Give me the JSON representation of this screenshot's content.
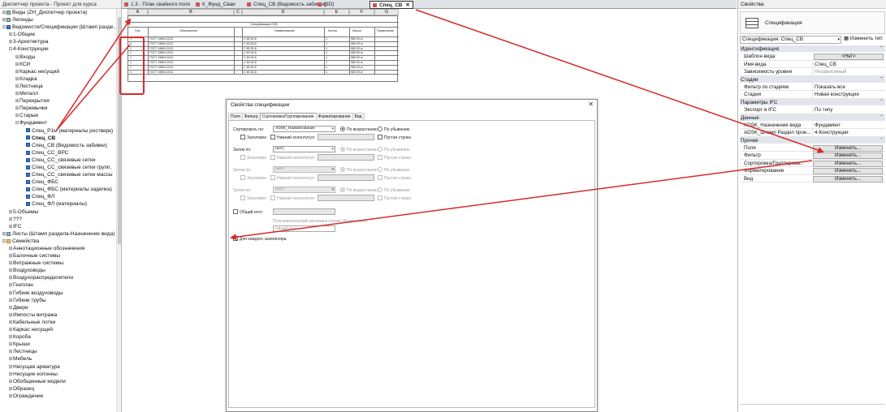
{
  "browser": {
    "title": "Диспетчер проекта - Проект для курса",
    "items": [
      {
        "label": "Виды (ZH_Диспетчер проекта)",
        "toggle": "⊞",
        "icon": "view",
        "indent": 0
      },
      {
        "label": "Легенды",
        "toggle": "⊞",
        "icon": "view",
        "indent": 0
      },
      {
        "label": "Ведомости/Спецификации (Штамп разде...",
        "toggle": "⊟",
        "icon": "sched",
        "indent": 0
      },
      {
        "label": "1-Общие",
        "toggle": "⊞",
        "icon": "",
        "indent": 1
      },
      {
        "label": "3-Архитектура",
        "toggle": "⊞",
        "icon": "",
        "indent": 1
      },
      {
        "label": "4-Конструкции",
        "toggle": "⊟",
        "icon": "",
        "indent": 1
      },
      {
        "label": "Входы",
        "toggle": "⊞",
        "icon": "",
        "indent": 2
      },
      {
        "label": "КСИ",
        "toggle": "⊞",
        "icon": "",
        "indent": 2
      },
      {
        "label": "Каркас несущий",
        "toggle": "⊞",
        "icon": "",
        "indent": 2
      },
      {
        "label": "Кладка",
        "toggle": "⊞",
        "icon": "",
        "indent": 2
      },
      {
        "label": "Лестница",
        "toggle": "⊞",
        "icon": "",
        "indent": 2
      },
      {
        "label": "Металл",
        "toggle": "⊞",
        "icon": "",
        "indent": 2
      },
      {
        "label": "Перекрытия",
        "toggle": "⊞",
        "icon": "",
        "indent": 2
      },
      {
        "label": "Перемычки",
        "toggle": "⊞",
        "icon": "",
        "indent": 2
      },
      {
        "label": "Старые",
        "toggle": "⊞",
        "icon": "",
        "indent": 2
      },
      {
        "label": "Фундамент",
        "toggle": "⊟",
        "icon": "",
        "indent": 2
      },
      {
        "label": "Спец_Р1м (материалы ростверк)",
        "toggle": "",
        "icon": "sched",
        "indent": 3
      },
      {
        "label": "Спец_СВ",
        "toggle": "",
        "icon": "sched",
        "indent": 3,
        "selected": true
      },
      {
        "label": "Спец_СВ (Ведомость забивки)",
        "toggle": "",
        "icon": "sched",
        "indent": 3
      },
      {
        "label": "Спец_СС_ВРС",
        "toggle": "",
        "icon": "sched",
        "indent": 3
      },
      {
        "label": "Спец_СС_связевые сетки",
        "toggle": "",
        "icon": "sched",
        "indent": 3
      },
      {
        "label": "Спец_СС_связевые сетки групп.",
        "toggle": "",
        "icon": "sched",
        "indent": 3
      },
      {
        "label": "Спец_СС_связевые сетки массы",
        "toggle": "",
        "icon": "sched",
        "indent": 3
      },
      {
        "label": "Спец_ФБС",
        "toggle": "",
        "icon": "sched",
        "indent": 3
      },
      {
        "label": "Спец_ФБС (материалы заделка)",
        "toggle": "",
        "icon": "sched",
        "indent": 3
      },
      {
        "label": "Спец_ФЛ",
        "toggle": "",
        "icon": "sched",
        "indent": 3
      },
      {
        "label": "Спец_ФЛ (материалы)",
        "toggle": "",
        "icon": "sched",
        "indent": 3
      },
      {
        "label": "5-Объемы",
        "toggle": "⊞",
        "icon": "",
        "indent": 1
      },
      {
        "label": "???",
        "toggle": "⊞",
        "icon": "",
        "indent": 1
      },
      {
        "label": "IFC",
        "toggle": "⊞",
        "icon": "",
        "indent": 1
      },
      {
        "label": "Листы (Штамп раздела-Назначение вида)",
        "toggle": "⊞",
        "icon": "view",
        "indent": 0
      },
      {
        "label": "Семейства",
        "toggle": "⊟",
        "icon": "folder",
        "indent": 0
      },
      {
        "label": "Аннотационные обозначения",
        "toggle": "⊞",
        "icon": "",
        "indent": 1
      },
      {
        "label": "Балочные системы",
        "toggle": "⊞",
        "icon": "",
        "indent": 1
      },
      {
        "label": "Витражные системы",
        "toggle": "⊞",
        "icon": "",
        "indent": 1
      },
      {
        "label": "Воздуховоды",
        "toggle": "⊞",
        "icon": "",
        "indent": 1
      },
      {
        "label": "Воздухораспределители",
        "toggle": "⊞",
        "icon": "",
        "indent": 1
      },
      {
        "label": "Генплан",
        "toggle": "⊞",
        "icon": "",
        "indent": 1
      },
      {
        "label": "Гибкие воздуховоды",
        "toggle": "⊞",
        "icon": "",
        "indent": 1
      },
      {
        "label": "Гибкие трубы",
        "toggle": "⊞",
        "icon": "",
        "indent": 1
      },
      {
        "label": "Двери",
        "toggle": "⊞",
        "icon": "",
        "indent": 1
      },
      {
        "label": "Импосты витража",
        "toggle": "⊞",
        "icon": "",
        "indent": 1
      },
      {
        "label": "Кабельные лотки",
        "toggle": "⊞",
        "icon": "",
        "indent": 1
      },
      {
        "label": "Каркас несущий",
        "toggle": "⊞",
        "icon": "",
        "indent": 1
      },
      {
        "label": "Короба",
        "toggle": "⊞",
        "icon": "",
        "indent": 1
      },
      {
        "label": "Крыши",
        "toggle": "⊞",
        "icon": "",
        "indent": 1
      },
      {
        "label": "Лестницы",
        "toggle": "⊞",
        "icon": "",
        "indent": 1
      },
      {
        "label": "Мебель",
        "toggle": "⊞",
        "icon": "",
        "indent": 1
      },
      {
        "label": "Несущая арматура",
        "toggle": "⊞",
        "icon": "",
        "indent": 1
      },
      {
        "label": "Несущие колонны",
        "toggle": "⊞",
        "icon": "",
        "indent": 1
      },
      {
        "label": "Обобщенные модели",
        "toggle": "⊞",
        "icon": "",
        "indent": 1
      },
      {
        "label": "Образец",
        "toggle": "⊞",
        "icon": "",
        "indent": 1
      },
      {
        "label": "Ограждение",
        "toggle": "⊞",
        "icon": "",
        "indent": 1
      }
    ]
  },
  "tabs": [
    {
      "label": "1.3 - План свайного поля",
      "active": false
    },
    {
      "label": "К_Фунд_Сваи",
      "active": false
    },
    {
      "label": "Спец_СВ (Ведомость забивки)",
      "active": false
    },
    {
      "label": "{3D}",
      "active": false
    },
    {
      "label": "Спец_СВ",
      "active": true,
      "close": "✕"
    }
  ],
  "schedule": {
    "columns": [
      "A",
      "B",
      "C",
      "D",
      "E",
      "F",
      "G"
    ],
    "title": "Спецификация (СВ)",
    "headers": [
      "Поз.",
      "Обозначение",
      "",
      "Наименование",
      "Кол-во",
      "Масса",
      "Примечание"
    ],
    "rows": [
      [
        "1",
        "ГОСТ 19804-2012",
        "",
        "С 80.30-6",
        "1",
        "980.00 кг",
        ""
      ],
      [
        "1",
        "ГОСТ 19804-2012",
        "",
        "С 80.30-6",
        "1",
        "980.00 кг",
        ""
      ],
      [
        "1",
        "ГОСТ 19804-2012",
        "",
        "С 80.30-6",
        "1",
        "980.00 кг",
        ""
      ],
      [
        "1",
        "ГОСТ 19804-2012",
        "",
        "С 80.30-6",
        "1",
        "980.00 кг",
        ""
      ],
      [
        "1",
        "ГОСТ 19804-2012",
        "",
        "С 80.30-6",
        "1",
        "980.00 кг",
        ""
      ],
      [
        "1",
        "ГОСТ 19804-2012",
        "",
        "С 80.30-6",
        "1",
        "980.00 кг",
        ""
      ],
      [
        "1",
        "ГОСТ 19804-2012",
        "",
        "С 80.30-6",
        "1",
        "980.00 кг",
        ""
      ],
      [
        "1",
        "ГОСТ 19804-2012",
        "",
        "С 80.30-6",
        "1",
        "980.00 кг",
        ""
      ]
    ]
  },
  "dialog": {
    "title": "Свойства спецификации",
    "close": "✕",
    "tabs": [
      "Поля",
      "Фильтр",
      "Сортировка/Группирование",
      "Форматирование",
      "Вид"
    ],
    "active_tab": 2,
    "sort_by_label": "Сортировать по:",
    "sort_by_value": "ADSK_Наименование",
    "then_by_label": "Затем по:",
    "then_by_value": "(нет)",
    "ascending": "По возрастанию",
    "descending": "По убыванию",
    "header": "Заголовок:",
    "footer": "Нижний колонтитул:",
    "blank_line": "Пустая строка",
    "grand_total": "Общий итог:",
    "custom_total_title_label": "Пользовательский заголовок строки общего итога:",
    "custom_total_title_value": "Общий итог",
    "itemize": "Для каждого экземпляра"
  },
  "props": {
    "title": "Свойства",
    "type_name": "Спецификация",
    "instance": "Спецификация: Спец_СВ",
    "edit_type": "Изменить тип",
    "groups": [
      {
        "name": "Идентификация",
        "rows": [
          {
            "key": "Шаблон вида",
            "value": "<Нет>",
            "button": true,
            "centered": true
          },
          {
            "key": "Имя вида",
            "value": "Спец_СВ"
          },
          {
            "key": "Зависимость уровня",
            "value": "Независимый",
            "disabled": true
          }
        ]
      },
      {
        "name": "Стадии",
        "rows": [
          {
            "key": "Фильтр по стадиям",
            "value": "Показать все"
          },
          {
            "key": "Стадия",
            "value": "Новая конструкция"
          }
        ]
      },
      {
        "name": "Параметры IFC",
        "rows": [
          {
            "key": "Экспорт в IFC",
            "value": "По типу"
          }
        ]
      },
      {
        "name": "Данные",
        "rows": [
          {
            "key": "ADSK_Назначение вида",
            "value": "Фундамент"
          },
          {
            "key": "ADSK_Штамп Раздел прое...",
            "value": "4-Конструкции"
          }
        ]
      },
      {
        "name": "Прочее",
        "rows": [
          {
            "key": "Поля",
            "value": "Изменить...",
            "button": true
          },
          {
            "key": "Фильтр",
            "value": "Изменить...",
            "button": true
          },
          {
            "key": "Сортировка/Группирова...",
            "value": "Изменить...",
            "button": true
          },
          {
            "key": "Форматирование",
            "value": "Изменить...",
            "button": true
          },
          {
            "key": "Вид",
            "value": "Изменить...",
            "button": true
          }
        ]
      }
    ]
  },
  "colors": {
    "annotation": "#d62b2b",
    "group_bg": "#e2e6ec"
  }
}
